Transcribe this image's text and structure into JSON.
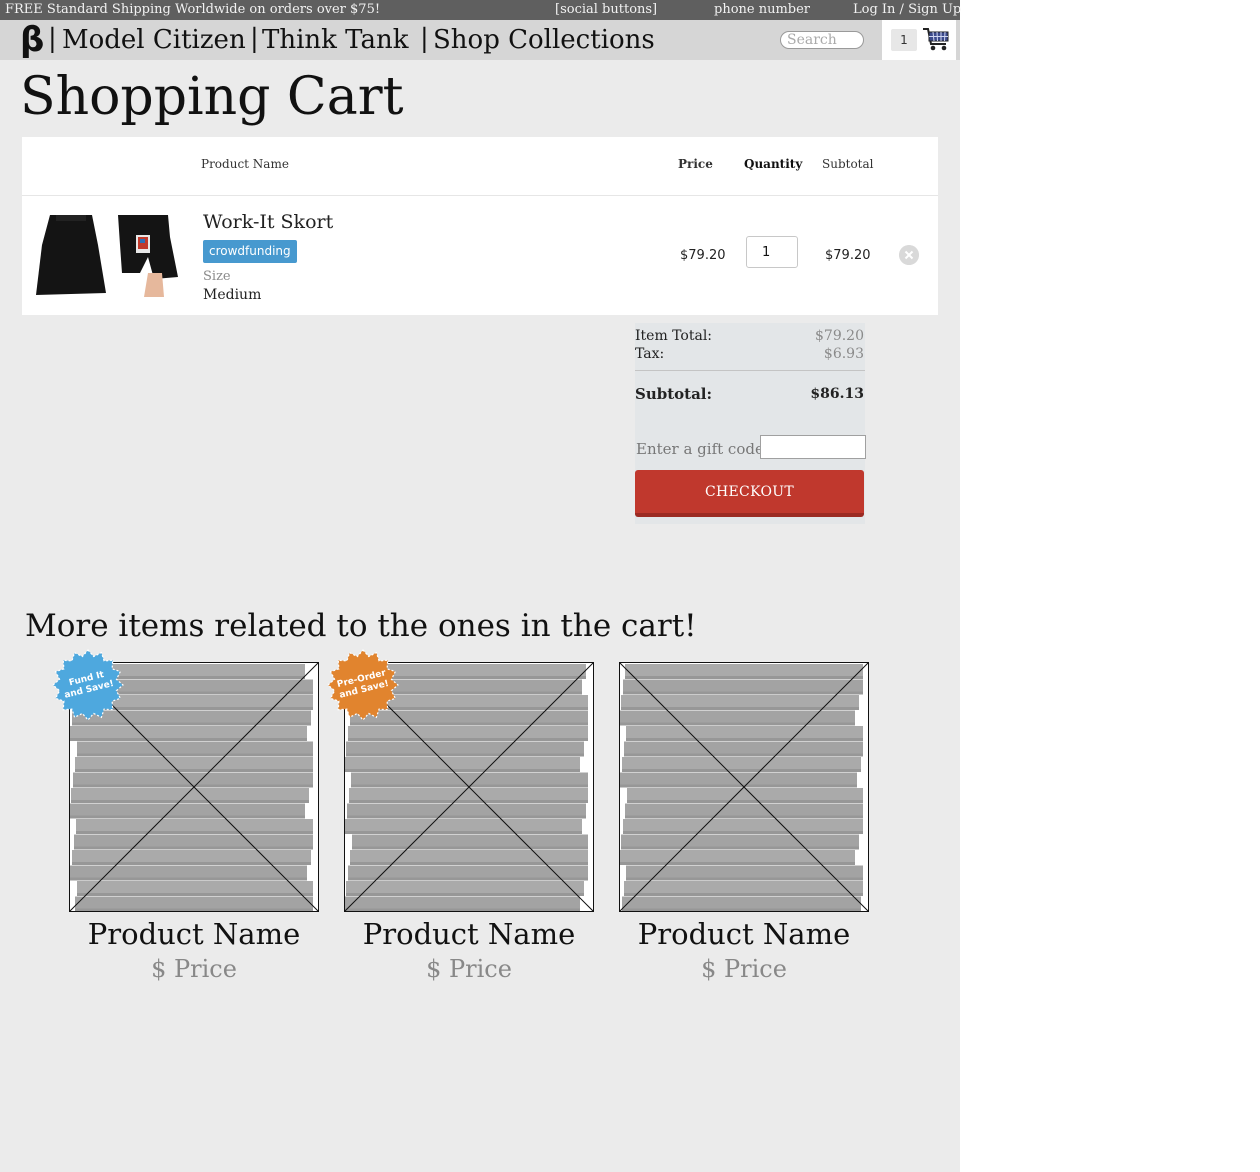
{
  "topbar": {
    "promo": "FREE Standard Shipping Worldwide on orders over $75!",
    "social": "[social buttons]",
    "phone": "phone number",
    "login": "Log In / Sign Up"
  },
  "nav": {
    "logo": "β",
    "separator": "|",
    "links": [
      "Model Citizen",
      "Think Tank",
      "Shop Collections"
    ],
    "search_placeholder": "Search",
    "cart_count": "1",
    "cart_icon": "shopping-cart-icon"
  },
  "page_title": "Shopping Cart",
  "cart": {
    "headers": {
      "product": "Product Name",
      "price": "Price",
      "quantity": "Quantity",
      "subtotal": "Subtotal"
    },
    "items": [
      {
        "name": "Work-It Skort",
        "badge": "crowdfunding",
        "size_label": "Size",
        "size_value": "Medium",
        "price": "$79.20",
        "quantity": "1",
        "subtotal": "$79.20",
        "remove_icon": "close-circle-icon"
      }
    ]
  },
  "summary": {
    "item_total_label": "Item Total:",
    "item_total": "$79.20",
    "tax_label": "Tax:",
    "tax": "$6.93",
    "subtotal_label": "Subtotal:",
    "subtotal": "$86.13",
    "gift_code_label": "Enter a gift code",
    "checkout_label": "CHECKOUT"
  },
  "related": {
    "title": "More items related to the ones in the cart!",
    "items": [
      {
        "name": "Product Name",
        "price": "$ Price",
        "badge": "Fund It and Save!",
        "badge_color": "#4ea8de"
      },
      {
        "name": "Product Name",
        "price": "$ Price",
        "badge": "Pre-Order and Save!",
        "badge_color": "#e1842e"
      },
      {
        "name": "Product Name",
        "price": "$ Price",
        "badge": "",
        "badge_color": ""
      }
    ]
  },
  "colors": {
    "checkout": "#c0382d",
    "badge_crowdfunding": "#4799cf",
    "topbar": "#5f5f5f",
    "nav": "#d6d6d6"
  }
}
